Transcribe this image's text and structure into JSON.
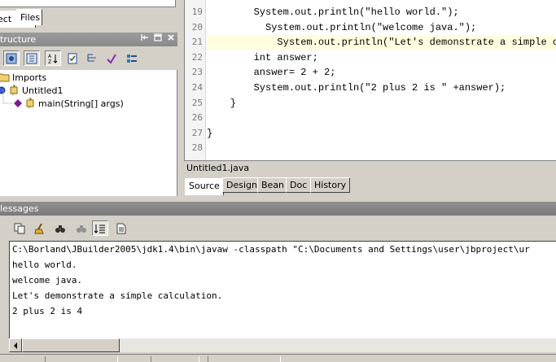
{
  "project_panel": {
    "tabs": [
      {
        "label": "ect",
        "active": false
      },
      {
        "label": "Files",
        "active": true
      }
    ]
  },
  "structure_panel": {
    "title": "tructure",
    "header_icons": [
      "dock-icon",
      "minimize-icon",
      "close-icon"
    ],
    "tree": [
      {
        "label": "Imports",
        "icon": "folder-icon"
      },
      {
        "label": "Untitled1",
        "icon": "class-icon"
      },
      {
        "label": "main(String[] args)",
        "icon": "method-icon"
      }
    ]
  },
  "editor": {
    "lines": [
      {
        "num": "19",
        "code": "        System.out.println(\"hello world.\");"
      },
      {
        "num": "20",
        "code": "          System.out.println(\"welcome java.\");"
      },
      {
        "num": "21",
        "code": "            System.out.println(\"Let's demonstrate a simple ca"
      },
      {
        "num": "22",
        "code": "        int answer;"
      },
      {
        "num": "23",
        "code": "        answer= 2 + 2;"
      },
      {
        "num": "24",
        "code": "        System.out.println(\"2 plus 2 is \" +answer);"
      },
      {
        "num": "25",
        "code": "    }"
      },
      {
        "num": "26",
        "code": ""
      },
      {
        "num": "27",
        "code": "}"
      },
      {
        "num": "28",
        "code": ""
      }
    ],
    "file_name": "Untitled1.java",
    "tabs": [
      "Source",
      "Design",
      "Bean",
      "Doc",
      "History"
    ],
    "active_tab": "Source"
  },
  "messages": {
    "title": "lessages",
    "output": [
      "C:\\Borland\\JBuilder2005\\jdk1.4\\bin\\javaw -classpath \"C:\\Documents and Settings\\user\\jbproject\\ur",
      "hello world.",
      "welcome java.",
      "Let's demonstrate a simple calculation.",
      "2 plus 2 is 4"
    ]
  },
  "colors": {
    "panel_bg": "#d4d0c8",
    "header_bg": "#8a8a8a",
    "highlight_line": "#ffffe0"
  }
}
